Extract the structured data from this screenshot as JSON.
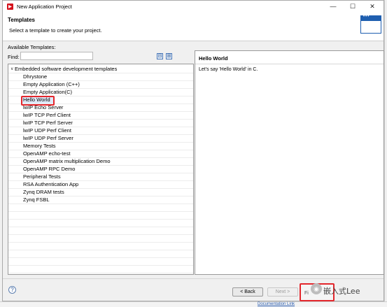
{
  "window": {
    "title": "New Application Project",
    "minimize": "—",
    "maximize": "☐",
    "close": "✕"
  },
  "banner": {
    "title": "Templates",
    "description": "Select a template to create your project."
  },
  "templates": {
    "available_label": "Available Templates:",
    "find_label": "Find:",
    "find_value": "",
    "collapse_btn": "⊟",
    "expand_btn": "⊞",
    "root": "Embedded software development templates",
    "items": [
      "Dhrystone",
      "Empty Application (C++)",
      "Empty Application(C)",
      "Hello World",
      "lwIP Echo Server",
      "lwIP TCP Perf Client",
      "lwIP TCP Perf Server",
      "lwIP UDP Perf Client",
      "lwIP UDP Perf Server",
      "Memory Tests",
      "OpenAMP echo-test",
      "OpenAMP matrix multiplication Demo",
      "OpenAMP RPC Demo",
      "Peripheral Tests",
      "RSA Authentication App",
      "Zynq DRAM tests",
      "Zynq FSBL"
    ],
    "selected": "Hello World"
  },
  "description": {
    "title": "Hello World",
    "body": "Let's say 'Hello World' in C."
  },
  "footer": {
    "help": "?",
    "back": "< Back",
    "next": "Next >",
    "finish": "Fi"
  },
  "watermark": "嵌入式Lee",
  "background": {
    "doc_link": "Documentation Link"
  },
  "colors": {
    "highlight": "#e3262c",
    "accent": "#1f5fb0"
  }
}
